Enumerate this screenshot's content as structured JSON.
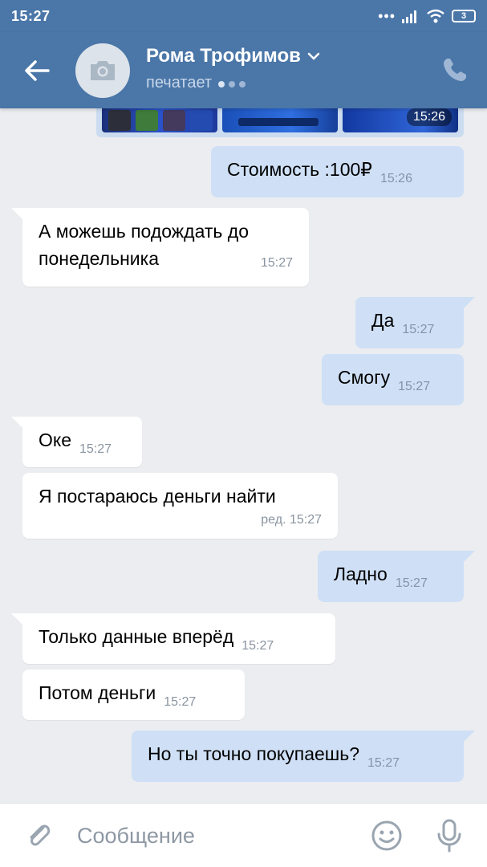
{
  "status": {
    "time": "15:27",
    "battery": "3"
  },
  "header": {
    "name": "Рома Трофимов",
    "status": "печатает"
  },
  "photo_preview": {
    "time": "15:26"
  },
  "messages": [
    {
      "dir": "out",
      "text": "Стоимость :100₽",
      "time": "15:26"
    },
    {
      "dir": "in",
      "text": "А можешь подождать до понедельника",
      "time": "15:27"
    },
    {
      "dir": "out",
      "text": "Да",
      "time": "15:27"
    },
    {
      "dir": "out",
      "text": "Смогу",
      "time": "15:27"
    },
    {
      "dir": "in",
      "text": "Оке",
      "time": "15:27"
    },
    {
      "dir": "in",
      "text": "Я постараюсь деньги найти",
      "time": "ред. 15:27"
    },
    {
      "dir": "out",
      "text": "Ладно",
      "time": "15:27"
    },
    {
      "dir": "in",
      "text": "Только данные вперёд",
      "time": "15:27"
    },
    {
      "dir": "in",
      "text": "Потом деньги",
      "time": "15:27"
    },
    {
      "dir": "out",
      "text": "Но ты точно покупаешь?",
      "time": "15:27"
    }
  ],
  "composer": {
    "placeholder": "Сообщение"
  },
  "colors": {
    "header": "#4a76a8",
    "outgoing": "#cfe0f6",
    "incoming": "#ffffff",
    "background": "#ebedf0"
  },
  "icons": [
    "back-arrow-icon",
    "camera-icon",
    "chevron-down-icon",
    "phone-icon",
    "paperclip-icon",
    "smile-icon",
    "microphone-icon"
  ]
}
